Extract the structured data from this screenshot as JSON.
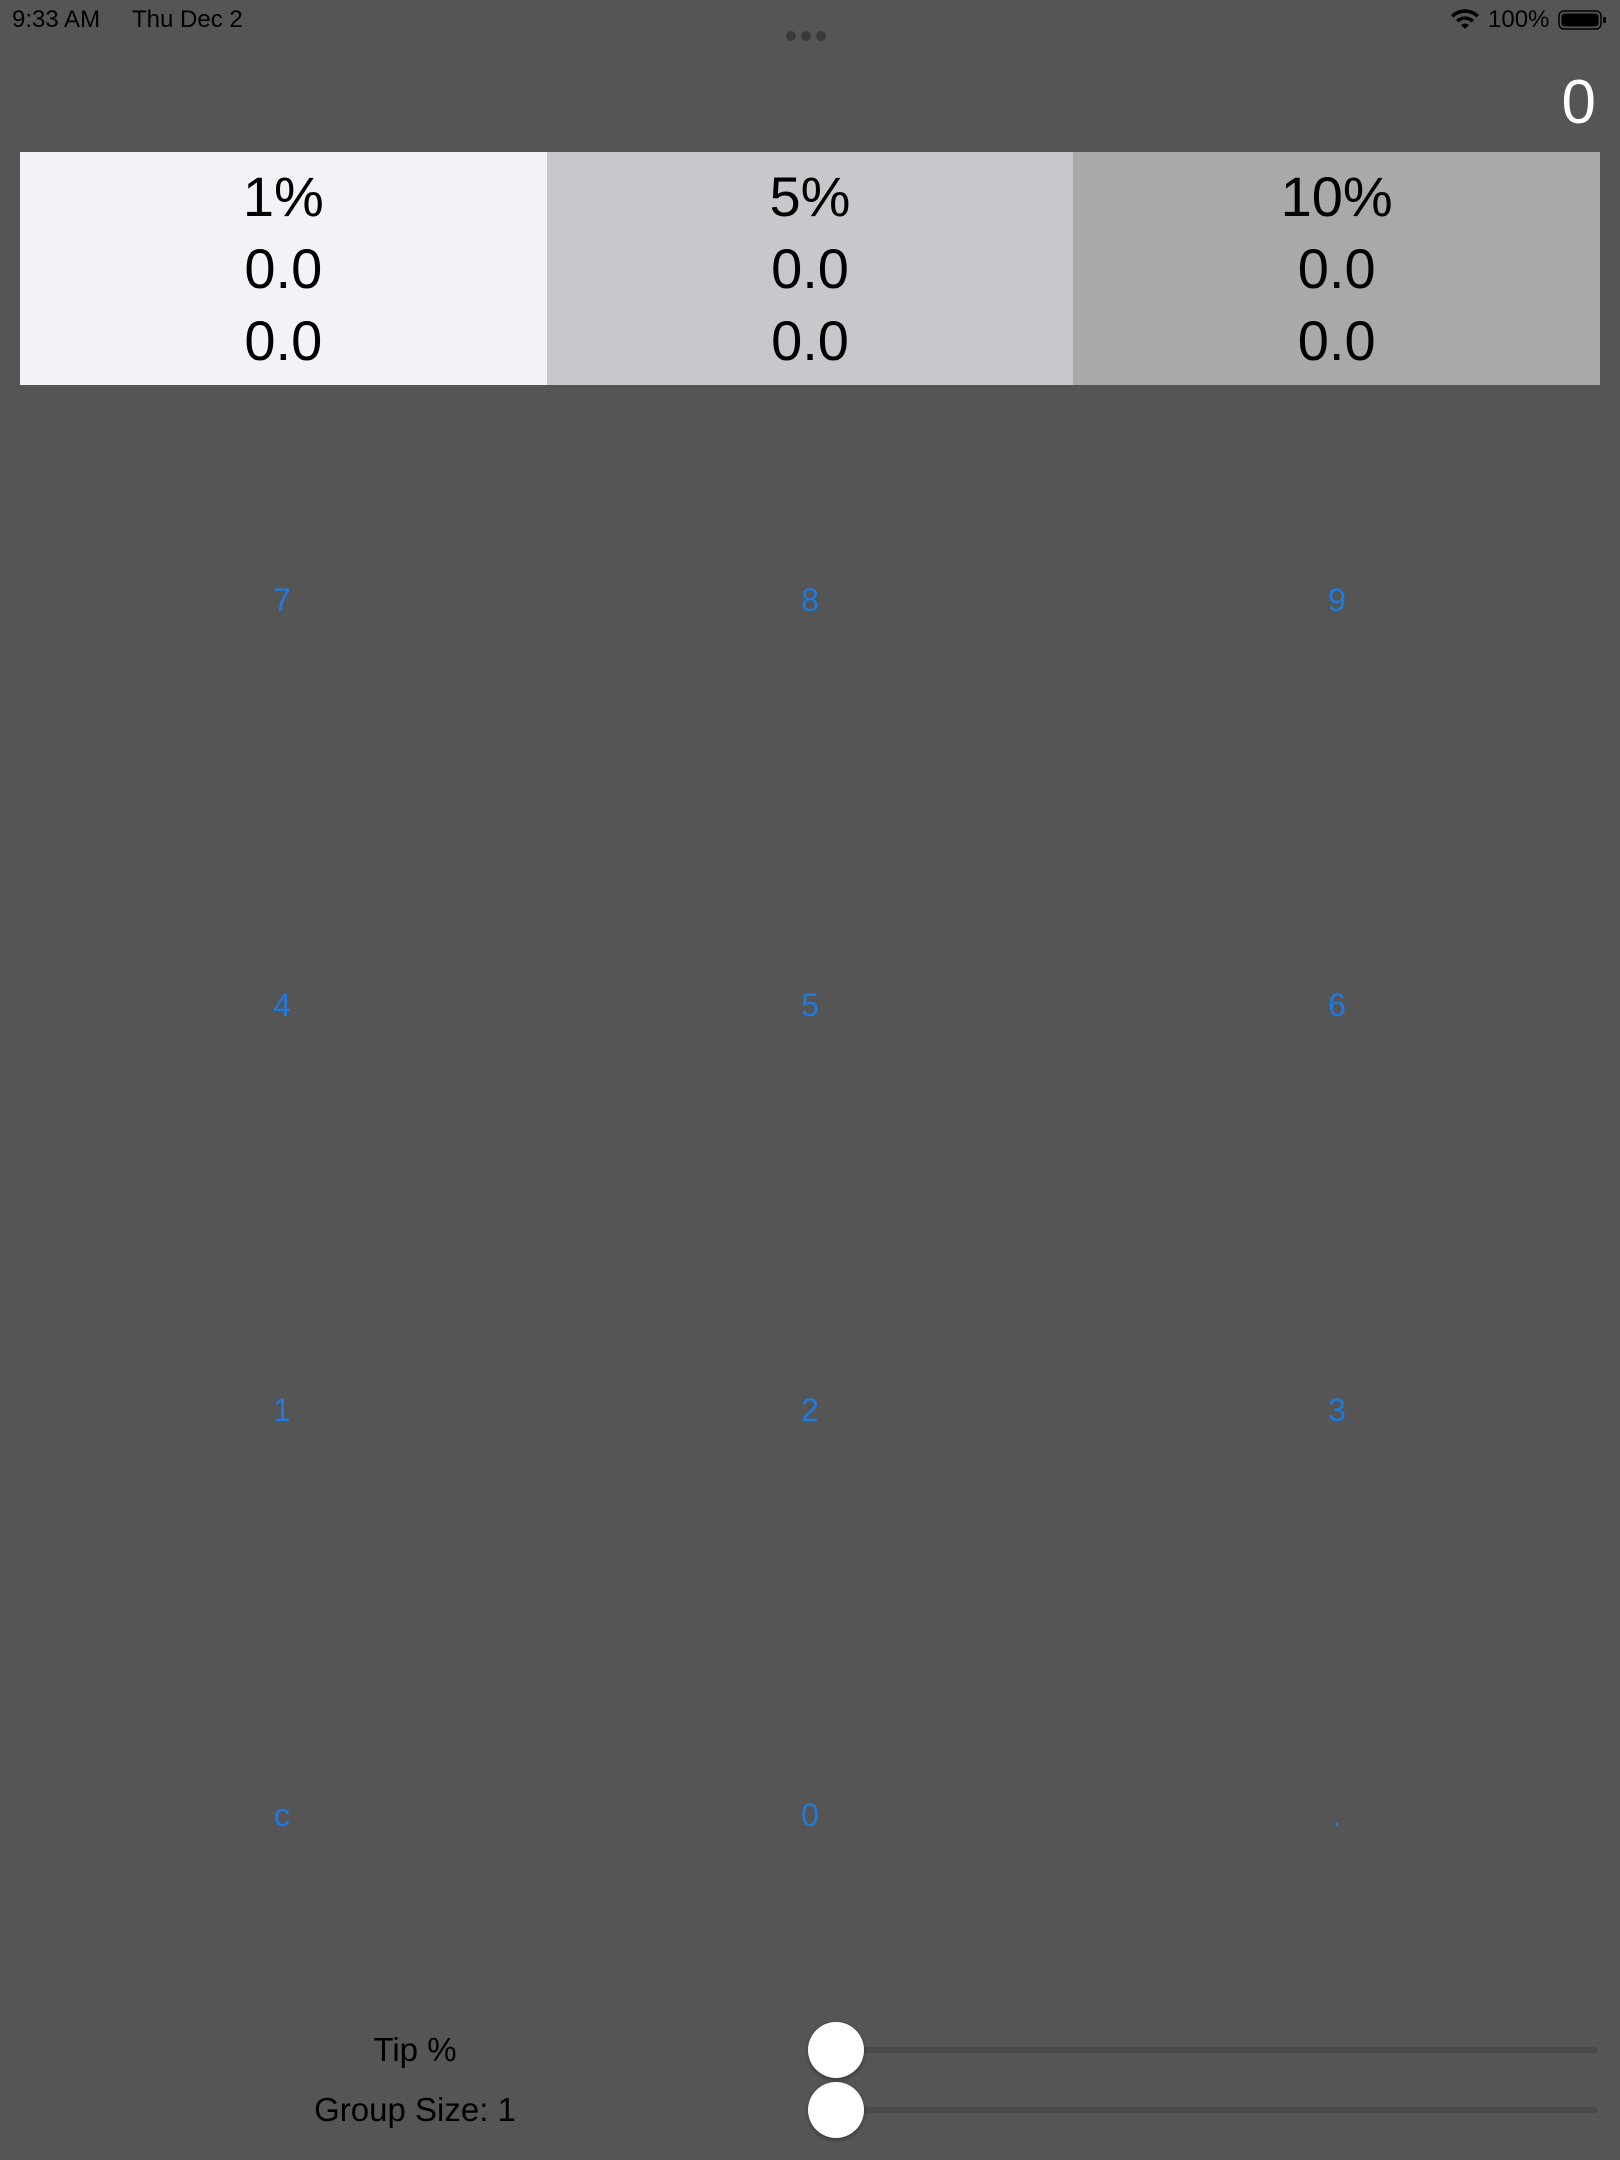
{
  "status_bar": {
    "time": "9:33 AM",
    "date": "Thu Dec 2",
    "battery_percent": "100%",
    "icons": [
      "multitask-dots-icon",
      "wifi-icon",
      "battery-icon"
    ]
  },
  "display": {
    "value": "0"
  },
  "tip_table": [
    {
      "percent": "1%",
      "tip": "0.0",
      "total": "0.0",
      "background": "#f2f2f7"
    },
    {
      "percent": "5%",
      "tip": "0.0",
      "total": "0.0",
      "background": "#c7c7cc"
    },
    {
      "percent": "10%",
      "tip": "0.0",
      "total": "0.0",
      "background": "#a9a9a9"
    }
  ],
  "keypad": {
    "keys": [
      "7",
      "8",
      "9",
      "4",
      "5",
      "6",
      "1",
      "2",
      "3",
      "c",
      "0",
      "."
    ]
  },
  "sliders": {
    "tip": {
      "label": "Tip %",
      "value_fraction": 0
    },
    "group_size": {
      "label": "Group Size: 1",
      "value_fraction": 0
    }
  },
  "colors": {
    "background": "#555555",
    "key_text": "#1f7ae0",
    "display_text": "#ffffff"
  }
}
